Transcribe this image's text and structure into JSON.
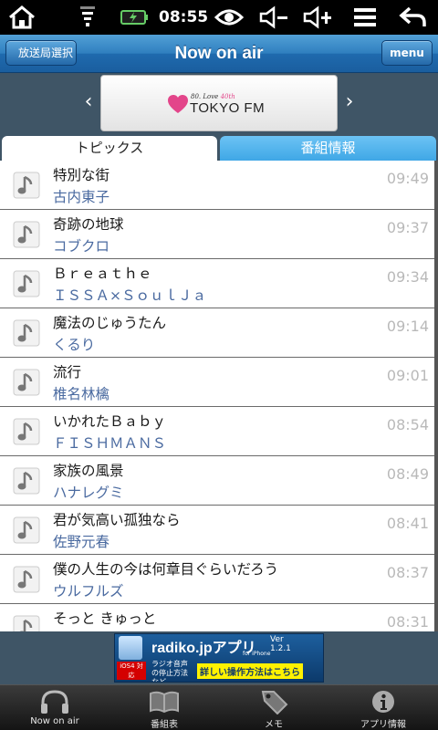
{
  "status_bar": {
    "time": "08:55"
  },
  "nav": {
    "back_label": "放送局選択",
    "title": "Now on air",
    "menu_label": "menu"
  },
  "station": {
    "prev": "‹",
    "next": "›",
    "logo_small_prefix": "80. Love",
    "logo_small_accent": "40th",
    "logo_text": "TOKYO FM"
  },
  "tabs": {
    "topics": "トピックス",
    "programs": "番組情報"
  },
  "list": {
    "items": [
      {
        "title": "特別な街",
        "artist": "古内東子",
        "time": "09:49"
      },
      {
        "title": "奇跡の地球",
        "artist": "コブクロ",
        "time": "09:37"
      },
      {
        "title": "Ｂｒｅａｔｈｅ",
        "artist": "ＩＳＳＡ×ＳｏｕｌＪａ",
        "time": "09:34"
      },
      {
        "title": "魔法のじゅうたん",
        "artist": "くるり",
        "time": "09:14"
      },
      {
        "title": "流行",
        "artist": "椎名林檎",
        "time": "09:01"
      },
      {
        "title": "いかれたＢａｂｙ",
        "artist": "ＦＩＳＨＭＡＮＳ",
        "time": "08:54"
      },
      {
        "title": "家族の風景",
        "artist": "ハナレグミ",
        "time": "08:49"
      },
      {
        "title": "君が気高い孤独なら",
        "artist": "佐野元春",
        "time": "08:41"
      },
      {
        "title": "僕の人生の今は何章目ぐらいだろう",
        "artist": "ウルフルズ",
        "time": "08:37"
      },
      {
        "title": "そっと きゅっと",
        "artist": "",
        "time": "08:31"
      }
    ]
  },
  "ad": {
    "brand": "radiko.jpアプリ",
    "ver_line1": "Ver",
    "ver_line2": "1.2.1",
    "for": "for iPhone",
    "ios": "iOS4 対応",
    "sub": "ラジオ音声の停止方法など",
    "link": "詳しい操作方法はこちら"
  },
  "tabbar": [
    {
      "label": "Now on air",
      "icon": "headphones-icon"
    },
    {
      "label": "番組表",
      "icon": "book-icon"
    },
    {
      "label": "メモ",
      "icon": "tag-icon"
    },
    {
      "label": "アプリ情報",
      "icon": "info-icon"
    }
  ]
}
